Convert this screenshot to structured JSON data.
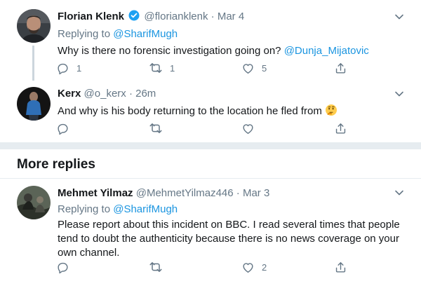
{
  "tweets": [
    {
      "name": "Florian Klenk",
      "handle": "@florianklenk",
      "dot": "·",
      "time": "Mar 4",
      "verified": true,
      "replying_prefix": "Replying to ",
      "replying_to": "@SharifMugh",
      "text": "Why is there no forensic investigation going on? ",
      "text_mention": "@Dunja_Mijatovic",
      "replies": "1",
      "retweets": "1",
      "likes": "5"
    },
    {
      "name": "Kerx",
      "handle": "@o_kerx",
      "dot": "·",
      "time": "26m",
      "text": "And why is his body returning to the location he fled from",
      "emoji": "thinking-face",
      "replies": "",
      "retweets": "",
      "likes": ""
    },
    {
      "name": "Mehmet Yilmaz",
      "handle": "@MehmetYilmaz446",
      "dot": "·",
      "time": "Mar 3",
      "replying_prefix": "Replying to ",
      "replying_to": "@SharifMugh",
      "text_lines": [
        "Please report about this incident on BBC. I read several times that people",
        "tend to doubt the authenticity because there is no news coverage on your",
        "own channel."
      ],
      "replies": "",
      "retweets": "",
      "likes": "2"
    }
  ],
  "section": {
    "more_replies": "More replies"
  },
  "colors": {
    "link": "#1b95e0",
    "muted": "#657786",
    "verified": "#1da1f2",
    "divider": "#e6ecf0"
  },
  "icons": [
    "reply-icon",
    "retweet-icon",
    "like-icon",
    "share-icon",
    "chevron-down-icon",
    "verified-badge-icon",
    "thinking-face-emoji"
  ]
}
